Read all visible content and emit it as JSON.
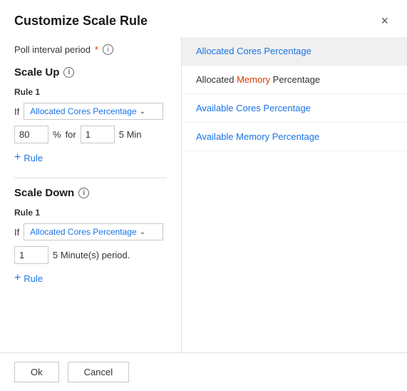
{
  "modal": {
    "title": "Customize Scale Rule",
    "close_label": "×"
  },
  "poll": {
    "label": "Poll interval period",
    "required": "*",
    "info": "i"
  },
  "scale_up": {
    "title": "Scale Up",
    "info": "i",
    "rule1_label": "Rule 1",
    "if_label": "If",
    "dropdown_value": "Allocated Cores Percentage",
    "number_value": "80",
    "percent": "%",
    "for_label": "for",
    "duration_value": "1",
    "min_text": "5 Min",
    "add_rule_label": "Rule"
  },
  "scale_down": {
    "title": "Scale Down",
    "info": "i",
    "rule1_label": "Rule 1",
    "if_label": "If",
    "dropdown_value": "Allocated Cores Percentage",
    "number_value": "1",
    "period_text": "5 Minute(s) period.",
    "add_rule_label": "Rule"
  },
  "footer": {
    "ok_label": "Ok",
    "cancel_label": "Cancel"
  },
  "dropdown_options": [
    {
      "id": "allocated-cores",
      "label": "Allocated Cores Percentage",
      "color": "blue",
      "selected": true
    },
    {
      "id": "allocated-memory",
      "label_prefix": "Allocated ",
      "label_colored": "Memory",
      "label_suffix": " Percentage",
      "color": "red",
      "selected": false
    },
    {
      "id": "available-cores",
      "label": "Available Cores Percentage",
      "color": "blue",
      "selected": false
    },
    {
      "id": "available-memory",
      "label": "Available Memory Percentage",
      "color": "blue",
      "selected": false
    }
  ]
}
